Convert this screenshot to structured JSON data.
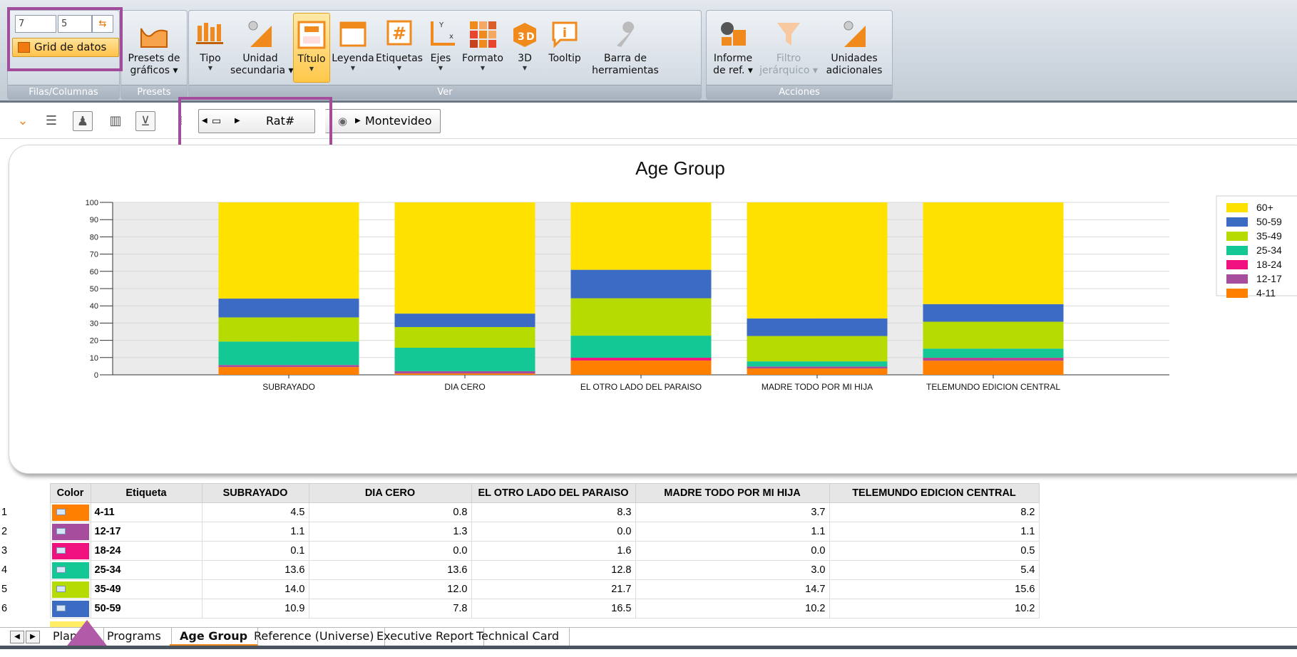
{
  "ribbon": {
    "rows_value": "7",
    "cols_value": "5",
    "grid_button": "Grid de datos",
    "groups": {
      "filas_columnas": "Filas/Columnas",
      "presets": "Presets",
      "ver": "Ver",
      "acciones": "Acciones"
    },
    "buttons": {
      "presets_1": "Presets de",
      "presets_2": "gráficos",
      "tipo": "Tipo",
      "unidad_1": "Unidad",
      "unidad_2": "secundaria",
      "titulo": "Título",
      "leyenda": "Leyenda",
      "etiquetas": "Etiquetas",
      "ejes": "Ejes",
      "formato": "Formato",
      "td": "3D",
      "tooltip": "Tooltip",
      "barra_1": "Barra de",
      "barra_2": "herramientas",
      "informe_1": "Informe",
      "informe_2": "de ref.",
      "filtro_1": "Filtro",
      "filtro_2": "jerárquico",
      "unidades_1": "Unidades",
      "unidades_2": "adicionales"
    }
  },
  "toolbar": {
    "measure": "Rat#",
    "region": "Montevideo"
  },
  "chart_data": {
    "type": "bar",
    "stacked": true,
    "title": "Age Group",
    "categories": [
      "SUBRAYADO",
      "DIA CERO",
      "EL OTRO LADO DEL PARAISO",
      "MADRE TODO POR MI HIJA",
      "TELEMUNDO EDICION CENTRAL"
    ],
    "ylim": [
      0,
      100
    ],
    "yticks": [
      0,
      10,
      20,
      30,
      40,
      50,
      60,
      70,
      80,
      90,
      100
    ],
    "legend_position": "right",
    "series": [
      {
        "name": "4-11",
        "color": "#ff8000",
        "values": [
          4.5,
          0.8,
          8.3,
          3.7,
          8.2
        ]
      },
      {
        "name": "12-17",
        "color": "#a64d9e",
        "values": [
          1.1,
          1.3,
          0.0,
          1.1,
          1.1
        ]
      },
      {
        "name": "18-24",
        "color": "#f0117e",
        "values": [
          0.1,
          0.0,
          1.6,
          0.0,
          0.5
        ]
      },
      {
        "name": "25-34",
        "color": "#14c895",
        "values": [
          13.6,
          13.6,
          12.8,
          3.0,
          5.4
        ]
      },
      {
        "name": "35-49",
        "color": "#b5db00",
        "values": [
          14.0,
          12.0,
          21.7,
          14.7,
          15.6
        ]
      },
      {
        "name": "50-59",
        "color": "#3c6bc4",
        "values": [
          10.9,
          7.8,
          16.5,
          10.2,
          10.2
        ]
      },
      {
        "name": "60+",
        "color": "#ffe100",
        "values": [
          55.8,
          64.5,
          39.1,
          67.3,
          59.0
        ]
      }
    ]
  },
  "table": {
    "headers": [
      "Color",
      "Etiqueta",
      "SUBRAYADO",
      "DIA CERO",
      "EL OTRO LADO DEL PARAISO",
      "MADRE TODO POR MI HIJA",
      "TELEMUNDO EDICION CENTRAL"
    ],
    "rows": [
      {
        "idx": "1",
        "label": "4-11",
        "values": [
          "4.5",
          "0.8",
          "8.3",
          "3.7",
          "8.2"
        ]
      },
      {
        "idx": "2",
        "label": "12-17",
        "values": [
          "1.1",
          "1.3",
          "0.0",
          "1.1",
          "1.1"
        ]
      },
      {
        "idx": "3",
        "label": "18-24",
        "values": [
          "0.1",
          "0.0",
          "1.6",
          "0.0",
          "0.5"
        ]
      },
      {
        "idx": "4",
        "label": "25-34",
        "values": [
          "13.6",
          "13.6",
          "12.8",
          "3.0",
          "5.4"
        ]
      },
      {
        "idx": "5",
        "label": "35-49",
        "values": [
          "14.0",
          "12.0",
          "21.7",
          "14.7",
          "15.6"
        ]
      },
      {
        "idx": "6",
        "label": "50-59",
        "values": [
          "10.9",
          "7.8",
          "16.5",
          "10.2",
          "10.2"
        ]
      }
    ]
  },
  "tabs": [
    "Planilla",
    "Programs",
    "Age Group",
    "Reference (Universe)",
    "Executive Report",
    "Technical Card"
  ],
  "active_tab": "Age Group"
}
